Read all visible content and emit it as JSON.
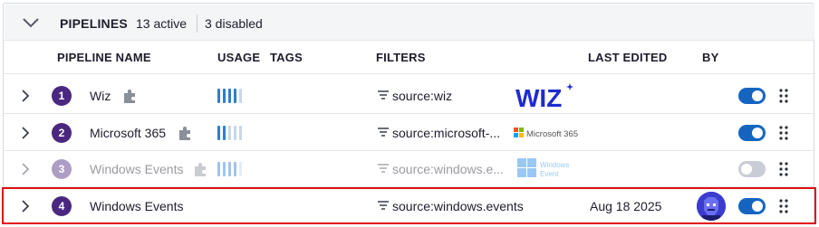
{
  "header": {
    "title": "PIPELINES",
    "active": "13 active",
    "disabled": "3 disabled"
  },
  "columns": {
    "name": "PIPELINE NAME",
    "usage": "USAGE",
    "tags": "TAGS",
    "filters": "FILTERS",
    "last_edited": "LAST EDITED",
    "by": "BY"
  },
  "rows": [
    {
      "index": "1",
      "name": "Wiz",
      "filter": "source:wiz",
      "logo": "WIZ",
      "usage_bars": 4,
      "enabled": true
    },
    {
      "index": "2",
      "name": "Microsoft 365",
      "filter": "source:microsoft-...",
      "logo": "Microsoft 365",
      "usage_bars": 2,
      "enabled": true
    },
    {
      "index": "3",
      "name": "Windows Events",
      "filter": "source:windows.e...",
      "logo": "Windows Event",
      "logo_line1": "Windows",
      "logo_line2": "Event",
      "usage_bars": 4,
      "enabled": false
    },
    {
      "index": "4",
      "name": "Windows Events",
      "filter": "source:windows.events",
      "last_edited": "Aug 18 2025",
      "enabled": true
    }
  ],
  "colors": {
    "accent": "#1565c0",
    "badge": "#4a2880",
    "highlight": "#e01010"
  },
  "icons": [
    "chevron-down-icon",
    "chevron-right-icon",
    "puzzle-icon",
    "usage-bars-icon",
    "filter-icon",
    "drag-handle-icon",
    "avatar"
  ]
}
